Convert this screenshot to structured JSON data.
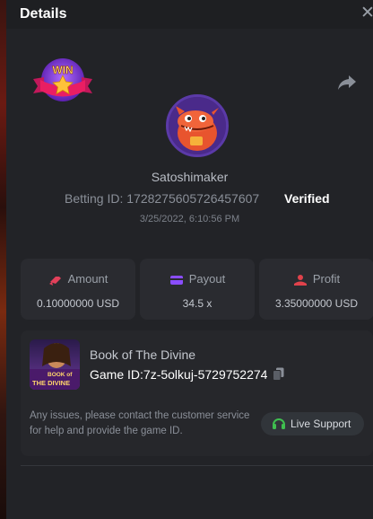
{
  "header": {
    "title": "Details"
  },
  "user": {
    "name": "Satoshimaker",
    "betting_id": "Betting ID: 1728275605726457607",
    "verified_label": "Verified",
    "timestamp": "3/25/2022, 6:10:56 PM"
  },
  "badge": {
    "text": "WIN"
  },
  "stats": {
    "amount": {
      "label": "Amount",
      "value": "0.10000000 USD"
    },
    "payout": {
      "label": "Payout",
      "value": "34.5 x"
    },
    "profit": {
      "label": "Profit",
      "value": "3.35000000 USD"
    }
  },
  "game": {
    "name": "Book of The Divine",
    "id_text": "Game ID:7z-5olkuj-5729752274",
    "thumb_text_line1": "BOOK of",
    "thumb_text_line2": "THE DIVINE"
  },
  "support": {
    "message": "Any issues, please contact the customer service for help and provide the game ID.",
    "button_label": "Live Support"
  },
  "colors": {
    "accent_green": "#3fbf4f",
    "amount_icon": "#e2405a",
    "payout_icon": "#8a4dff",
    "profit_icon": "#e0424b"
  }
}
